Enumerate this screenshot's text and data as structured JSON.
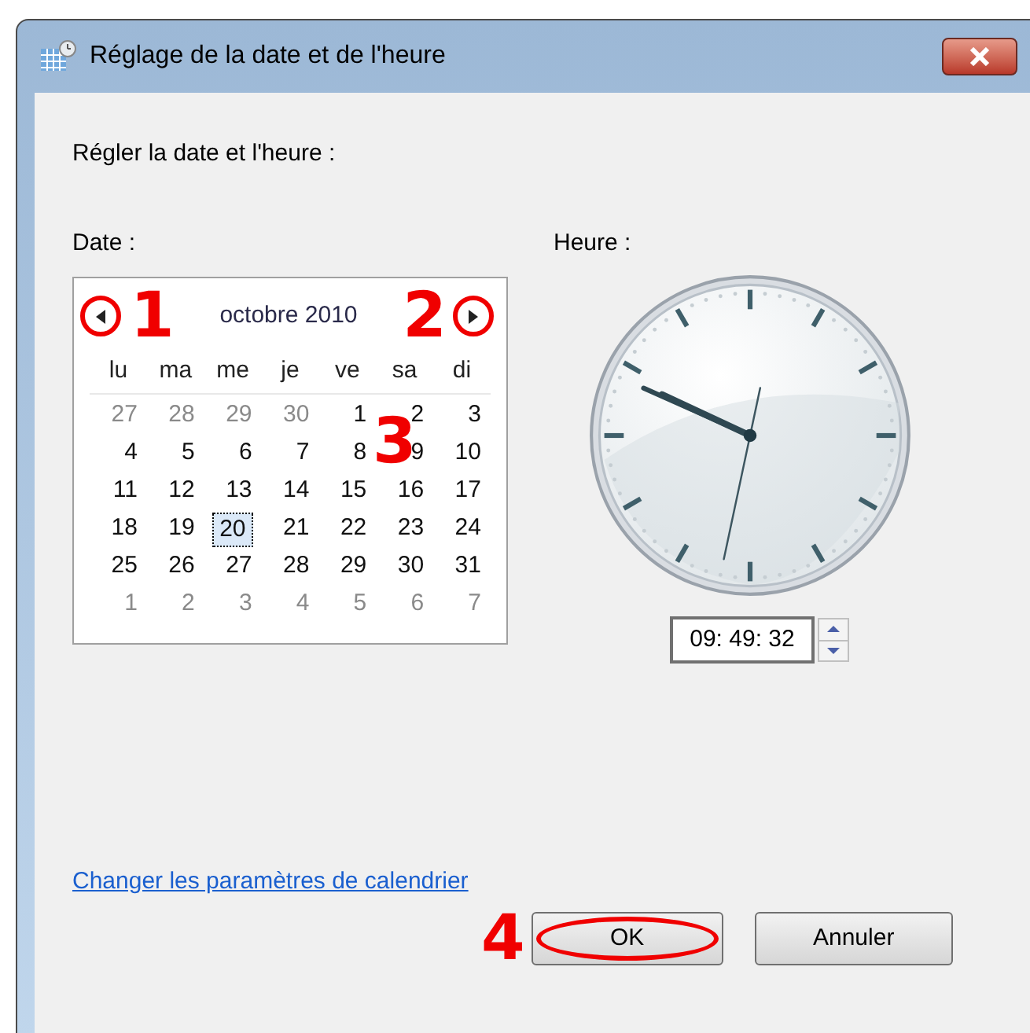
{
  "window": {
    "title": "Réglage de la date et de l'heure"
  },
  "heading": "Régler la date et l'heure :",
  "date": {
    "label": "Date :",
    "month": "octobre 2010",
    "weekdays": [
      "lu",
      "ma",
      "me",
      "je",
      "ve",
      "sa",
      "di"
    ],
    "days": [
      {
        "text": "27",
        "other_month": true,
        "selected": false
      },
      {
        "text": "28",
        "other_month": true,
        "selected": false
      },
      {
        "text": "29",
        "other_month": true,
        "selected": false
      },
      {
        "text": "30",
        "other_month": true,
        "selected": false
      },
      {
        "text": "1",
        "other_month": false,
        "selected": false
      },
      {
        "text": "2",
        "other_month": false,
        "selected": false
      },
      {
        "text": "3",
        "other_month": false,
        "selected": false
      },
      {
        "text": "4",
        "other_month": false,
        "selected": false
      },
      {
        "text": "5",
        "other_month": false,
        "selected": false
      },
      {
        "text": "6",
        "other_month": false,
        "selected": false
      },
      {
        "text": "7",
        "other_month": false,
        "selected": false
      },
      {
        "text": "8",
        "other_month": false,
        "selected": false
      },
      {
        "text": "9",
        "other_month": false,
        "selected": false
      },
      {
        "text": "10",
        "other_month": false,
        "selected": false
      },
      {
        "text": "11",
        "other_month": false,
        "selected": false
      },
      {
        "text": "12",
        "other_month": false,
        "selected": false
      },
      {
        "text": "13",
        "other_month": false,
        "selected": false
      },
      {
        "text": "14",
        "other_month": false,
        "selected": false
      },
      {
        "text": "15",
        "other_month": false,
        "selected": false
      },
      {
        "text": "16",
        "other_month": false,
        "selected": false
      },
      {
        "text": "17",
        "other_month": false,
        "selected": false
      },
      {
        "text": "18",
        "other_month": false,
        "selected": false
      },
      {
        "text": "19",
        "other_month": false,
        "selected": false
      },
      {
        "text": "20",
        "other_month": false,
        "selected": true
      },
      {
        "text": "21",
        "other_month": false,
        "selected": false
      },
      {
        "text": "22",
        "other_month": false,
        "selected": false
      },
      {
        "text": "23",
        "other_month": false,
        "selected": false
      },
      {
        "text": "24",
        "other_month": false,
        "selected": false
      },
      {
        "text": "25",
        "other_month": false,
        "selected": false
      },
      {
        "text": "26",
        "other_month": false,
        "selected": false
      },
      {
        "text": "27",
        "other_month": false,
        "selected": false
      },
      {
        "text": "28",
        "other_month": false,
        "selected": false
      },
      {
        "text": "29",
        "other_month": false,
        "selected": false
      },
      {
        "text": "30",
        "other_month": false,
        "selected": false
      },
      {
        "text": "31",
        "other_month": false,
        "selected": false
      },
      {
        "text": "1",
        "other_month": true,
        "selected": false
      },
      {
        "text": "2",
        "other_month": true,
        "selected": false
      },
      {
        "text": "3",
        "other_month": true,
        "selected": false
      },
      {
        "text": "4",
        "other_month": true,
        "selected": false
      },
      {
        "text": "5",
        "other_month": true,
        "selected": false
      },
      {
        "text": "6",
        "other_month": true,
        "selected": false
      },
      {
        "text": "7",
        "other_month": true,
        "selected": false
      }
    ]
  },
  "time": {
    "label": "Heure :",
    "value": "09: 49: 32"
  },
  "link": "Changer les paramètres de calendrier",
  "buttons": [
    "OK",
    "Annuler"
  ],
  "annotations": [
    "1",
    "2",
    "3",
    "4"
  ]
}
